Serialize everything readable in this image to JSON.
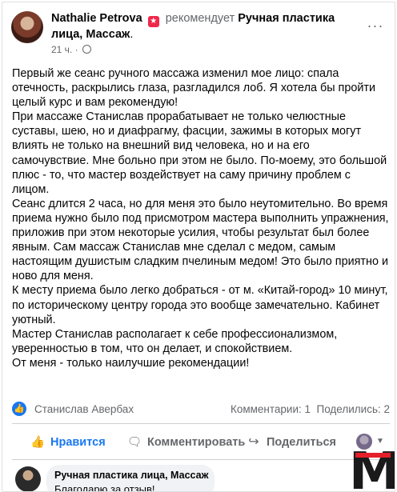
{
  "post": {
    "author_name": "Nathalie Petrova",
    "recommend_text": "рекомендует",
    "page_name": "Ручная пластика лица, Массаж",
    "time": "21 ч.",
    "paragraphs": [
      "Первый же сеанс ручного массажа изменил мое лицо: спала отечность, раскрылись глаза, разгладился лоб. Я хотела бы пройти целый курс и вам рекомендую!",
      "При массаже Станислав прорабатывает не только челюстные суставы, шею, но и диафрагму, фасции, зажимы в которых могут влиять не только на внешний вид человека, но и на его самочувствие. Мне больно при этом не было. По-моему, это большой плюс - то, что мастер воздействует на саму причину проблем с лицом.",
      "Сеанс длится 2 часа, но для меня это было неутомительно. Во время приема нужно было под присмотром мастера выполнить упражнения, приложив при этом некоторые усилия, чтобы результат был более явным. Сам массаж Станислав мне сделал с медом, самым настоящим душистым сладким пчелиным медом! Это было приятно и ново для меня.",
      "К месту приема было легко добраться - от м. «Китай-город» 10 минут, по историческому центру города это вообще замечательно. Кабинет уютный.",
      "Мастер Станислав располагает к себе профессионализмом, уверенностью в том, что он делает, и спокойствием.",
      "От меня - только наилучшие рекомендации!"
    ]
  },
  "stats": {
    "reactor": "Станислав Авербах",
    "comments": "Комментарии: 1",
    "shares": "Поделились: 2"
  },
  "actions": {
    "like": "Нравится",
    "comment": "Комментировать",
    "share": "Поделиться"
  },
  "comment": {
    "author": "Ручная пластика лица, Массаж",
    "text": "Благодарю за отзыв!"
  },
  "watermark": {
    "letter": "M"
  },
  "colors": {
    "brand": "#1877f2",
    "secondary_text": "#65676b",
    "recommend_badge": "#f02849",
    "watermark_red": "#e41e2b"
  },
  "icons": [
    "recommend-star-icon",
    "globe-icon",
    "more-dots-icon",
    "like-badge-icon",
    "thumbs-up-icon",
    "comment-icon",
    "share-icon",
    "caret-down-icon"
  ]
}
